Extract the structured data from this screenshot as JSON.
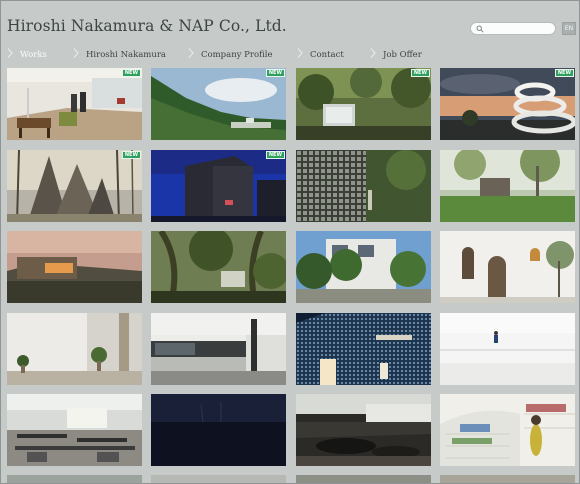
{
  "header": {
    "title": "Hiroshi Nakamura & NAP Co., Ltd.",
    "search_placeholder": "",
    "lang_label": "EN"
  },
  "nav": {
    "items": [
      {
        "label": "Works",
        "active": true
      },
      {
        "label": "Hiroshi Nakamura",
        "active": false
      },
      {
        "label": "Company Profile",
        "active": false
      },
      {
        "label": "Contact",
        "active": false
      },
      {
        "label": "Job Offer",
        "active": false
      }
    ]
  },
  "badge_label": "NEW",
  "colors": {
    "background": "#c6cbc9",
    "text": "#3d4444",
    "active_nav": "#fbfdfd",
    "new_badge": "#2fa05d"
  },
  "gallery": {
    "tiles": [
      {
        "name": "works-tile-interior-dining",
        "new": true
      },
      {
        "name": "works-tile-green-hills",
        "new": true
      },
      {
        "name": "works-tile-forest-pavilion",
        "new": true
      },
      {
        "name": "works-tile-spiral-building",
        "new": true
      },
      {
        "name": "works-tile-triangular-roofs",
        "new": true
      },
      {
        "name": "works-tile-dark-cube-night",
        "new": true
      },
      {
        "name": "works-tile-lattice-facade",
        "new": false
      },
      {
        "name": "works-tile-garden-house",
        "new": false
      },
      {
        "name": "works-tile-sunset-house",
        "new": false
      },
      {
        "name": "works-tile-palm-trees",
        "new": false
      },
      {
        "name": "works-tile-white-house-trees",
        "new": false
      },
      {
        "name": "works-tile-arched-doorway",
        "new": false
      },
      {
        "name": "works-tile-white-room-plants",
        "new": false
      },
      {
        "name": "works-tile-modern-villa",
        "new": false
      },
      {
        "name": "works-tile-lit-storefront",
        "new": false
      },
      {
        "name": "works-tile-white-loft",
        "new": false
      },
      {
        "name": "works-tile-office-workspace",
        "new": false
      },
      {
        "name": "works-tile-night-field",
        "new": false
      },
      {
        "name": "works-tile-dark-lounge",
        "new": false
      },
      {
        "name": "works-tile-bookshelf-room",
        "new": false
      }
    ]
  }
}
